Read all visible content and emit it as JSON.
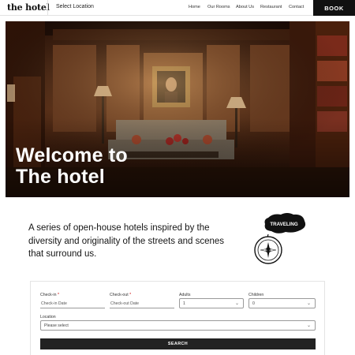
{
  "header": {
    "logo": "the hotel",
    "location_selector": "Select Location",
    "nav": [
      "Home",
      "Our Rooms",
      "About Us",
      "Restaurant",
      "Contact"
    ],
    "book_label": "BOOK"
  },
  "hero": {
    "title_line1": "Welcome to",
    "title_line2": "The hotel"
  },
  "intro": {
    "text": "A series of open-house hotels inspired by the diversity and originality of the streets and scenes that surround us.",
    "badge": "TRAVELING"
  },
  "booking": {
    "checkin_label": "Check-in",
    "checkin_placeholder": "Check-in Date",
    "checkout_label": "Check-out",
    "checkout_placeholder": "Check-out Date",
    "adults_label": "Adults",
    "adults_value": "1",
    "children_label": "Children",
    "children_value": "0",
    "location_label": "Location",
    "location_value": "Please select",
    "required_mark": "*",
    "search_label": "SEARCH"
  },
  "icons": {
    "dropdown": "chevron-down-icon",
    "compass": "compass-icon"
  }
}
